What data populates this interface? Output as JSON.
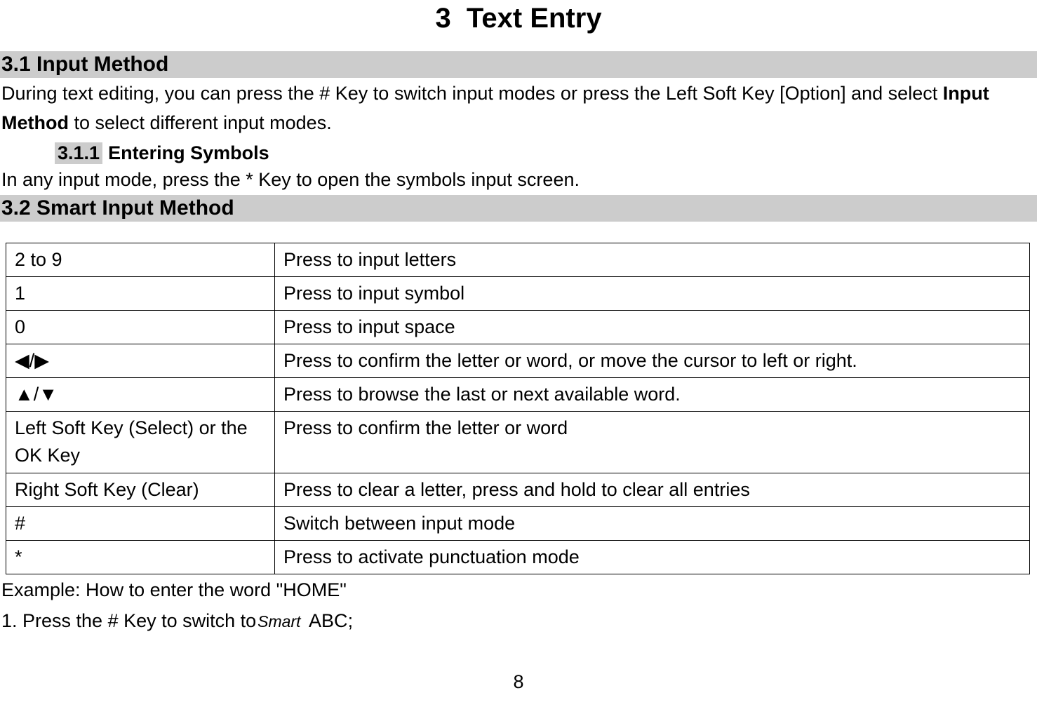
{
  "chapter": {
    "number": "3",
    "title": "Text Entry"
  },
  "section31": {
    "heading": "3.1 Input Method",
    "para_a": "During text editing, you can press the # Key to switch input modes or press the Left Soft Key [Option] and select ",
    "para_bold": "Input Method",
    "para_b": " to select different input modes."
  },
  "sub311": {
    "num": "3.1.1",
    "title": "Entering Symbols",
    "para": "In any input mode, press the * Key to open the symbols input screen."
  },
  "section32": {
    "heading": "3.2 Smart Input Method"
  },
  "table": {
    "rows": [
      {
        "key": "2 to 9",
        "desc": "Press to input letters"
      },
      {
        "key": "1",
        "desc": "Press to input symbol"
      },
      {
        "key": "0",
        "desc": "Press to input space"
      },
      {
        "key": "◀/▶",
        "desc": "Press to confirm the letter or word, or move the cursor to left or right."
      },
      {
        "key": "▲/▼",
        "desc": "Press to browse the last or next available word."
      },
      {
        "key": "Left Soft Key (Select) or the OK Key",
        "desc": "Press to confirm the letter or word"
      },
      {
        "key": "Right Soft Key (Clear)",
        "desc": "Press to clear a letter, press and hold to clear all entries"
      },
      {
        "key": "#",
        "desc": "Switch between input mode"
      },
      {
        "key": "*",
        "desc": "Press to activate punctuation mode"
      }
    ]
  },
  "example": {
    "title": "Example: How to enter the word \"HOME\"",
    "step1_a": "1. Press the # Key to switch to",
    "smart_icon": "Smart",
    "step1_bold": "ABC",
    "step1_tail": ";"
  },
  "page_number": "8"
}
